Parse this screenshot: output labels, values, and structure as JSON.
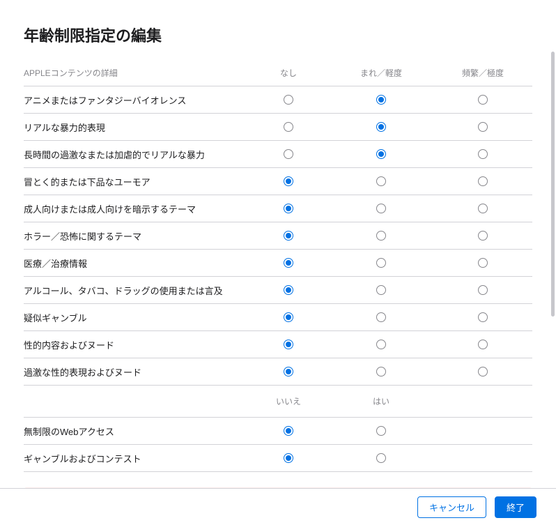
{
  "title": "年齢制限指定の編集",
  "table1": {
    "header": "APPLEコンテンツの詳細",
    "columns": [
      "なし",
      "まれ／軽度",
      "頻繁／極度"
    ],
    "rows": [
      {
        "label": "アニメまたはファンタジーバイオレンス",
        "selected": 1
      },
      {
        "label": "リアルな暴力的表現",
        "selected": 1
      },
      {
        "label": "長時間の過激なまたは加虐的でリアルな暴力",
        "selected": 1
      },
      {
        "label": "冒とく的または下品なユーモア",
        "selected": 0
      },
      {
        "label": "成人向けまたは成人向けを暗示するテーマ",
        "selected": 0
      },
      {
        "label": "ホラー／恐怖に関するテーマ",
        "selected": 0
      },
      {
        "label": "医療／治療情報",
        "selected": 0
      },
      {
        "label": "アルコール、タバコ、ドラッグの使用または言及",
        "selected": 0
      },
      {
        "label": "疑似ギャンブル",
        "selected": 0
      },
      {
        "label": "性的内容およびヌード",
        "selected": 0
      },
      {
        "label": "過激な性的表現およびヌード",
        "selected": 0
      }
    ]
  },
  "table2": {
    "columns": [
      "いいえ",
      "はい"
    ],
    "rows": [
      {
        "label": "無制限のWebアクセス",
        "selected": 0
      },
      {
        "label": "ギャンブルおよびコンテスト",
        "selected": 0
      }
    ]
  },
  "buttons": {
    "cancel": "キャンセル",
    "done": "終了"
  }
}
